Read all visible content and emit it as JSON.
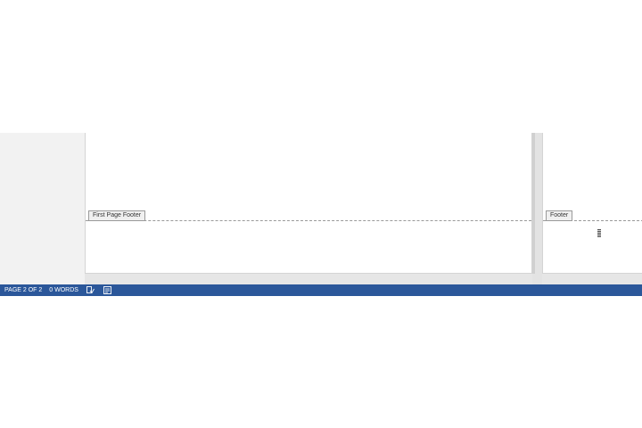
{
  "document": {
    "pages": [
      {
        "footer_label": "First Page Footer"
      },
      {
        "footer_label": "Footer"
      }
    ]
  },
  "status_bar": {
    "page_indicator": "PAGE 2 OF 2",
    "word_count": "0 WORDS",
    "icons": [
      "proofing-icon",
      "macro-recording-icon"
    ],
    "background_color": "#2b579a"
  }
}
